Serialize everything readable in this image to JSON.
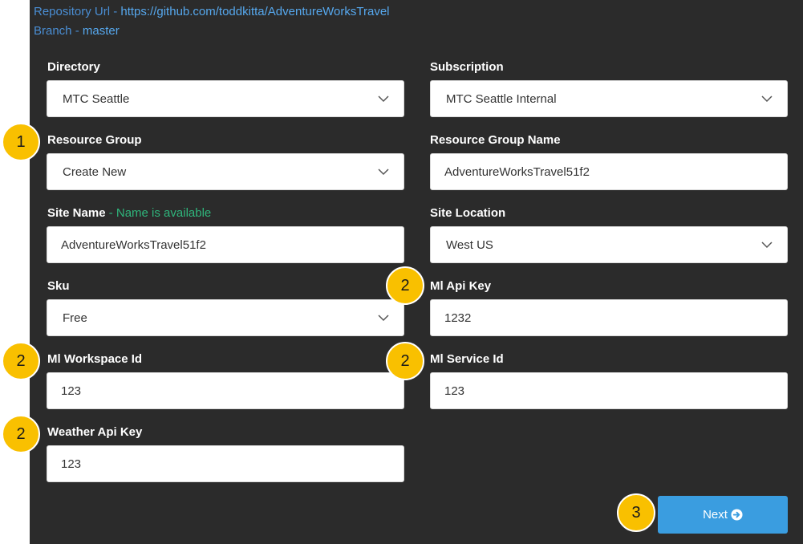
{
  "repo": {
    "url_label": "Repository Url - ",
    "url_value": "https://github.com/toddkitta/AdventureWorksTravel",
    "branch_label": "Branch - ",
    "branch_value": "master"
  },
  "form": {
    "directory": {
      "label": "Directory",
      "value": "MTC Seattle"
    },
    "subscription": {
      "label": "Subscription",
      "value": "MTC Seattle Internal"
    },
    "resource_group": {
      "label": "Resource Group",
      "value": "Create New"
    },
    "resource_group_name": {
      "label": "Resource Group Name",
      "value": "AdventureWorksTravel51f2"
    },
    "site_name": {
      "label": "Site Name",
      "status": " - Name is available",
      "value": "AdventureWorksTravel51f2"
    },
    "site_location": {
      "label": "Site Location",
      "value": "West US"
    },
    "sku": {
      "label": "Sku",
      "value": "Free"
    },
    "ml_api_key": {
      "label": "Ml Api Key",
      "value": "1232"
    },
    "ml_workspace_id": {
      "label": "Ml Workspace Id",
      "value": "123"
    },
    "ml_service_id": {
      "label": "Ml Service Id",
      "value": "123"
    },
    "weather_api_key": {
      "label": "Weather Api Key",
      "value": "123"
    }
  },
  "next_button": {
    "label": "Next",
    "icon": "arrow-circle-right-icon"
  },
  "callouts": {
    "one": "1",
    "two": "2",
    "three": "3"
  },
  "colors": {
    "panel_bg": "#2b2b2b",
    "link": "#56a8ee",
    "available": "#2fb67c",
    "button": "#3a9de0",
    "callout": "#f9c000"
  }
}
